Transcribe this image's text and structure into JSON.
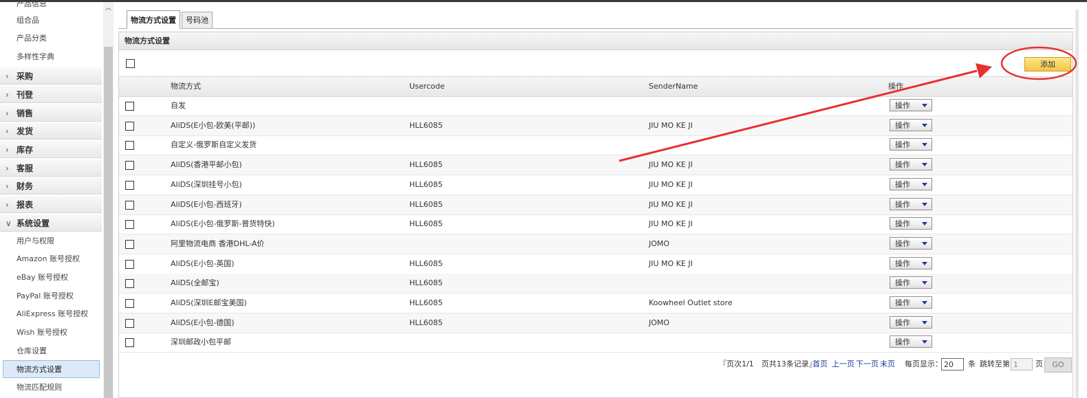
{
  "sidebar": {
    "items": [
      {
        "label": "产品信息",
        "type": "sub"
      },
      {
        "label": "组合品",
        "type": "sub"
      },
      {
        "label": "产品分类",
        "type": "sub"
      },
      {
        "label": "多样性字典",
        "type": "sub"
      },
      {
        "label": "采购",
        "type": "cat"
      },
      {
        "label": "刊登",
        "type": "cat"
      },
      {
        "label": "销售",
        "type": "cat"
      },
      {
        "label": "发货",
        "type": "cat"
      },
      {
        "label": "库存",
        "type": "cat"
      },
      {
        "label": "客服",
        "type": "cat"
      },
      {
        "label": "财务",
        "type": "cat"
      },
      {
        "label": "报表",
        "type": "cat"
      },
      {
        "label": "系统设置",
        "type": "cat_open"
      },
      {
        "label": "用户与权限",
        "type": "sub"
      },
      {
        "label": "Amazon 账号授权",
        "type": "sub"
      },
      {
        "label": "eBay 账号授权",
        "type": "sub"
      },
      {
        "label": "PayPal 账号授权",
        "type": "sub"
      },
      {
        "label": "AliExpress 账号授权",
        "type": "sub"
      },
      {
        "label": "Wish 账号授权",
        "type": "sub"
      },
      {
        "label": "仓库设置",
        "type": "sub"
      },
      {
        "label": "物流方式设置",
        "type": "active"
      },
      {
        "label": "物流匹配规则",
        "type": "sub"
      }
    ]
  },
  "tabs": [
    {
      "label": "物流方式设置",
      "active": true
    },
    {
      "label": "号码池",
      "active": false
    }
  ],
  "panel": {
    "title": "物流方式设置",
    "add_label": "添加"
  },
  "table": {
    "headers": [
      "物流方式",
      "Usercode",
      "SenderName",
      "操作"
    ],
    "action_label": "操作",
    "rows": [
      {
        "method": "自发",
        "usercode": "",
        "sender": ""
      },
      {
        "method": "AliDS(E小包-欧美(平邮))",
        "usercode": "HLL6085",
        "sender": "JIU MO KE JI"
      },
      {
        "method": "自定义-俄罗斯自定义发货",
        "usercode": "",
        "sender": ""
      },
      {
        "method": "AliDS(香港平邮小包)",
        "usercode": "HLL6085",
        "sender": "JIU MO KE JI"
      },
      {
        "method": "AliDS(深圳挂号小包)",
        "usercode": "HLL6085",
        "sender": "JIU MO KE JI"
      },
      {
        "method": "AliDS(E小包-西班牙)",
        "usercode": "HLL6085",
        "sender": "JIU MO KE JI"
      },
      {
        "method": "AliDS(E小包-俄罗斯-普货特快)",
        "usercode": "HLL6085",
        "sender": "JIU MO KE JI"
      },
      {
        "method": "阿里物流电商 香港DHL-A价",
        "usercode": "",
        "sender": "JOMO"
      },
      {
        "method": "AliDS(E小包-英国)",
        "usercode": "HLL6085",
        "sender": "JIU MO KE JI"
      },
      {
        "method": "AliDS(全邮宝)",
        "usercode": "HLL6085",
        "sender": ""
      },
      {
        "method": "AliDS(深圳E邮宝美国)",
        "usercode": "HLL6085",
        "sender": "Koowheel Outlet store"
      },
      {
        "method": "AliDS(E小包-德国)",
        "usercode": "HLL6085",
        "sender": "JOMO"
      },
      {
        "method": "深圳邮政小包平邮",
        "usercode": "",
        "sender": ""
      }
    ]
  },
  "pager": {
    "summary": "『页次1/1　页共13条记录』",
    "first": "首页",
    "prev": "上一页",
    "next": "下一页",
    "last": "末页",
    "per_page_label": "每页显示：",
    "per_page_value": "20",
    "unit": "条",
    "jump_label": "跳转至第",
    "jump_value": "1",
    "page_unit": "页",
    "go_label": "GO"
  },
  "colors": {
    "accent": "#f5c540",
    "annotation": "#e8312f",
    "link": "#1a3d9a"
  }
}
